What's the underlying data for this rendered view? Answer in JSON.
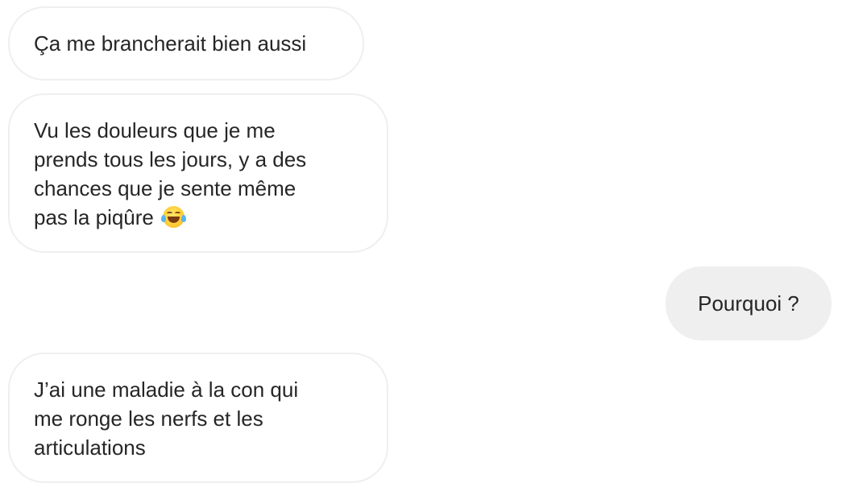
{
  "messages": [
    {
      "direction": "received",
      "lines": [
        "Ça me brancherait bien aussi"
      ]
    },
    {
      "direction": "received",
      "lines": [
        "Vu les douleurs que je me",
        "prends tous les jours, y a des",
        "chances que je sente même",
        "pas la piqûre"
      ],
      "emoji": "face-with-tears-of-joy-icon"
    },
    {
      "direction": "sent",
      "lines": [
        "Pourquoi ?"
      ]
    },
    {
      "direction": "received",
      "lines": [
        "J’ai une maladie à la con qui",
        "me ronge les nerfs et les",
        "articulations"
      ]
    }
  ],
  "colors": {
    "received_bubble_bg": "#ffffff",
    "received_bubble_border": "#efefef",
    "sent_bubble_bg": "#efefef",
    "text": "#262626"
  }
}
